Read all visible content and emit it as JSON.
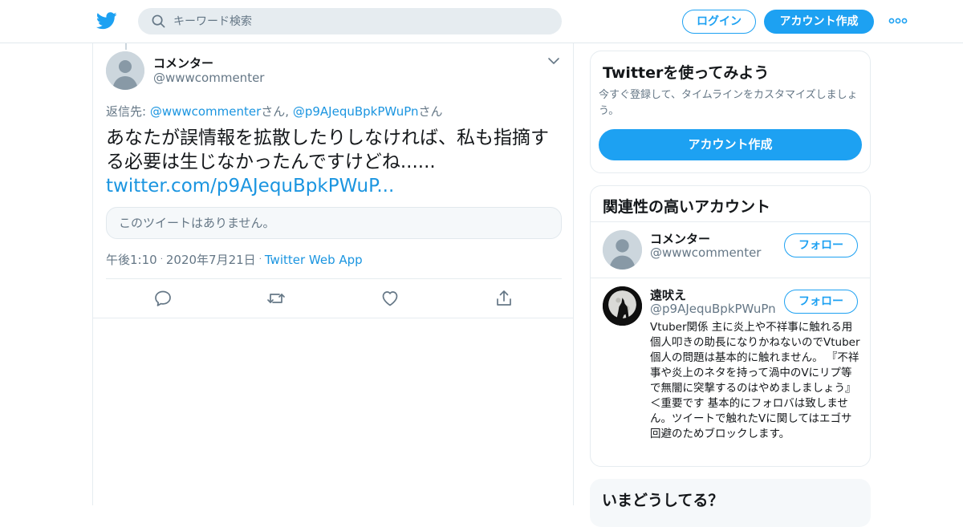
{
  "header": {
    "search_placeholder": "キーワード検索",
    "login_label": "ログイン",
    "signup_label": "アカウント作成",
    "brand_color": "#1da1f2"
  },
  "tweet": {
    "author_name": "コメンター",
    "author_handle": "@wwwcommenter",
    "reply_prefix": "返信先: ",
    "reply_user1": "@wwwcommenter",
    "reply_san1": "さん, ",
    "reply_user2": "@p9AJequBpkPWuPn",
    "reply_san2": "さん",
    "text": "あなたが誤情報を拡散したりしなければ、私も指摘する必要は生じなかったんですけどね......",
    "link": "twitter.com/p9AJequBpkPWuP...",
    "quote_unavailable": "このツイートはありません。",
    "time": "午後1:10",
    "date": "2020年7月21日",
    "source": "Twitter Web App",
    "icons": {
      "reply": "reply-icon",
      "retweet": "retweet-icon",
      "like": "heart-icon",
      "share": "share-icon"
    }
  },
  "sidebar": {
    "signup_card": {
      "title": "Twitterを使ってみよう",
      "description": "今すぐ登録して、タイムラインをカスタマイズしましょう。",
      "button": "アカウント作成"
    },
    "related_card": {
      "title": "関連性の高いアカウント",
      "accounts": [
        {
          "name": "コメンター",
          "handle": "@wwwcommenter",
          "follow": "フォロー"
        },
        {
          "name": "遠吠え",
          "handle": "@p9AJequBpkPWuPn",
          "follow": "フォロー",
          "bio": "Vtuber関係 主に炎上や不祥事に触れる用 個人叩きの助長になりかねないのでVtuber個人の問題は基本的に触れません。 『不祥事や炎上のネタを持って渦中のVにリプ等で無闇に突撃するのはやめましましょう』＜重要です 基本的にフォロバは致しません。ツイートで触れたVに関してはエゴサ回避のためブロックします。"
        }
      ]
    },
    "trends_card": {
      "title": "いまどうしてる？"
    }
  }
}
